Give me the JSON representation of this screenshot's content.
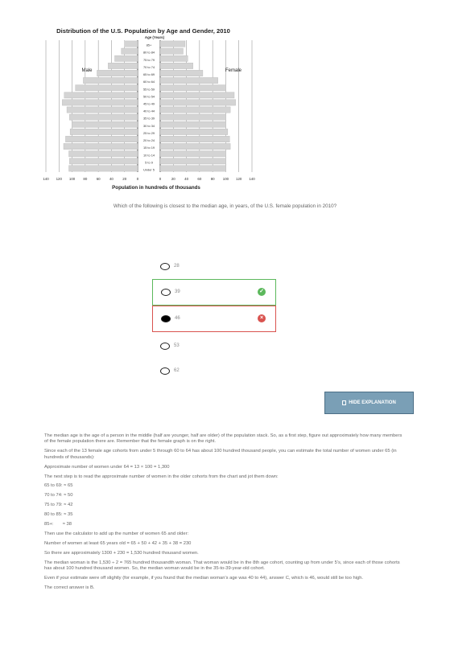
{
  "chart_data": {
    "type": "bar",
    "title": "Distribution of the U.S. Population by Age and Gender, 2010",
    "center_label": "Age (Years)",
    "xlabel": "Population in hundreds of thousands",
    "xlim": [
      0,
      140
    ],
    "x_ticks": [
      "140",
      "120",
      "100",
      "80",
      "60",
      "40",
      "20",
      "0",
      "0",
      "20",
      "40",
      "60",
      "80",
      "100",
      "120",
      "140"
    ],
    "categories": [
      "85+",
      "80 to 84",
      "75 to 79",
      "70 to 74",
      "65 to 69",
      "60 to 64",
      "55 to 59",
      "50 to 54",
      "45 to 49",
      "40 to 44",
      "35 to 39",
      "30 to 34",
      "25 to 29",
      "20 to 24",
      "15 to 19",
      "10 to 14",
      "5 to 9",
      "Under 5"
    ],
    "series": [
      {
        "name": "Male",
        "values": [
          20,
          25,
          35,
          45,
          62,
          83,
          95,
          112,
          115,
          108,
          104,
          100,
          103,
          110,
          113,
          105,
          104,
          105
        ]
      },
      {
        "name": "Female",
        "values": [
          38,
          35,
          42,
          50,
          65,
          88,
          100,
          113,
          115,
          107,
          100,
          100,
          103,
          106,
          107,
          100,
          100,
          100
        ]
      }
    ],
    "grid": true,
    "legend": "inline"
  },
  "question": "Which of the following is closest to the median age, in years, of the U.S. female population in 2010?",
  "choices": [
    {
      "label": "28"
    },
    {
      "label": "39"
    },
    {
      "label": "46"
    },
    {
      "label": "53"
    },
    {
      "label": "62"
    }
  ],
  "colors": {
    "correct": "#5cb85c",
    "wrong": "#d9534f",
    "button": "#7a9fb6",
    "bar": "#d4d4d4"
  },
  "hide_button_label": "HIDE EXPLANATION",
  "explanation": [
    "The median age is the age of a person in the middle (half are younger, half are older) of the population stack. So, as a first step, figure out approximately how many members of the female population there are. Remember that the female graph is on the right.",
    "Since each of the 13 female age cohorts from under 5 through 60 to 64 has about 100 hundred thousand people, you can estimate the total number of women under 65 (in hundreds of thousands):",
    "Approximate number of women under 64 = 13 × 100 = 1,300",
    "The next step is to read the approximate number of women in the older cohorts from the chart and jot them down:",
    "65 to 69: ≈ 65",
    "70 to 74: ≈ 50",
    "75 to 79: ≈ 42",
    "80 to 85: ≈ 35",
    "85+:       ≈ 38",
    "Then use the calculator to add up the number of women 65 and older:",
    "Number of women at least 65 years old = 65 + 50 + 42 + 35 + 38 = 230",
    "So there are approximately 1300 + 230 = 1,530 hundred thousand women.",
    "The median woman is the 1,530 ÷ 2 = 765 hundred thousandth woman. That woman would be in the 8th age cohort, counting up from under 5's, since each of those cohorts has about 100 hundred thousand women. So, the median woman would be in the 35-to-39-year-old cohort.",
    "Even if your estimate were off slightly (for example, if you found that the median woman's age was 40 to 44), answer C, which is 46, would still be too high.",
    "The correct answer is B."
  ]
}
